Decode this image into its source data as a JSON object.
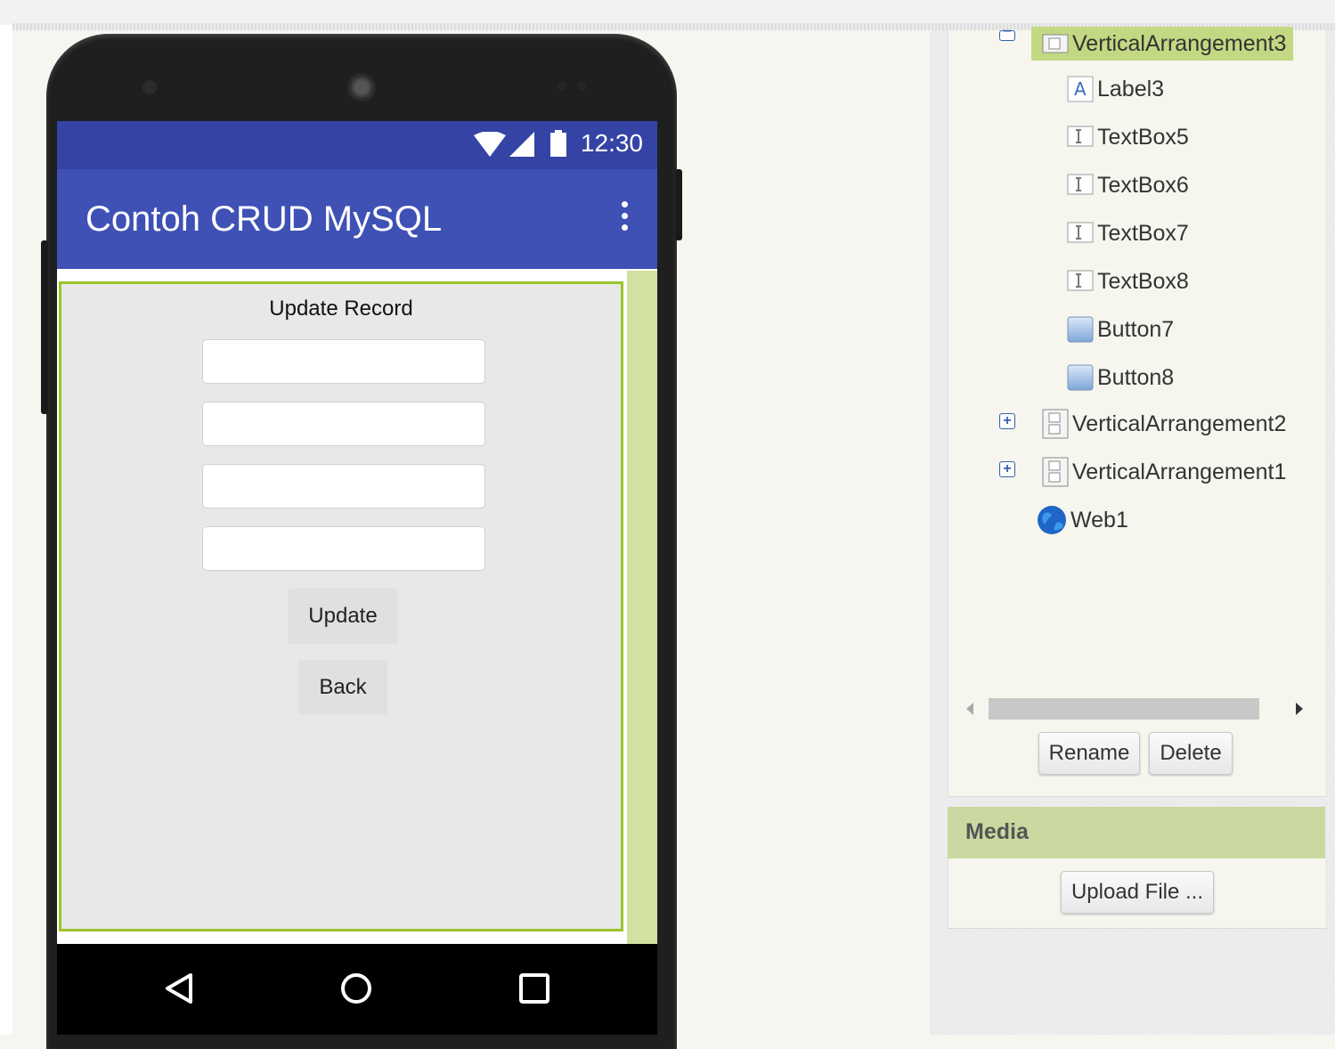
{
  "phone": {
    "status_time": "12:30",
    "app_title": "Contoh CRUD MySQL",
    "form": {
      "heading": "Update Record",
      "textbox_values": [
        "",
        "",
        "",
        ""
      ],
      "update_label": "Update",
      "back_label": "Back"
    }
  },
  "components": {
    "items": [
      {
        "label": "VerticalArrangement3",
        "icon": "vertical-arrangement-icon",
        "toggle": "collapse",
        "selected": true
      },
      {
        "label": "Label3",
        "icon": "label-icon"
      },
      {
        "label": "TextBox5",
        "icon": "textbox-icon"
      },
      {
        "label": "TextBox6",
        "icon": "textbox-icon"
      },
      {
        "label": "TextBox7",
        "icon": "textbox-icon"
      },
      {
        "label": "TextBox8",
        "icon": "textbox-icon"
      },
      {
        "label": "Button7",
        "icon": "button-icon"
      },
      {
        "label": "Button8",
        "icon": "button-icon"
      },
      {
        "label": "VerticalArrangement2",
        "icon": "vertical-arrangement-icon",
        "toggle": "expand"
      },
      {
        "label": "VerticalArrangement1",
        "icon": "vertical-arrangement-icon",
        "toggle": "expand"
      },
      {
        "label": "Web1",
        "icon": "globe-icon"
      }
    ],
    "rename_label": "Rename",
    "delete_label": "Delete"
  },
  "media": {
    "title": "Media",
    "upload_label": "Upload File ..."
  },
  "colors": {
    "status_bar": "#3443a4",
    "app_bar": "#3f51b5",
    "arrangement_border": "#9bc32a",
    "selected_bg": "#c3d882",
    "media_header": "#c9d9a0"
  }
}
